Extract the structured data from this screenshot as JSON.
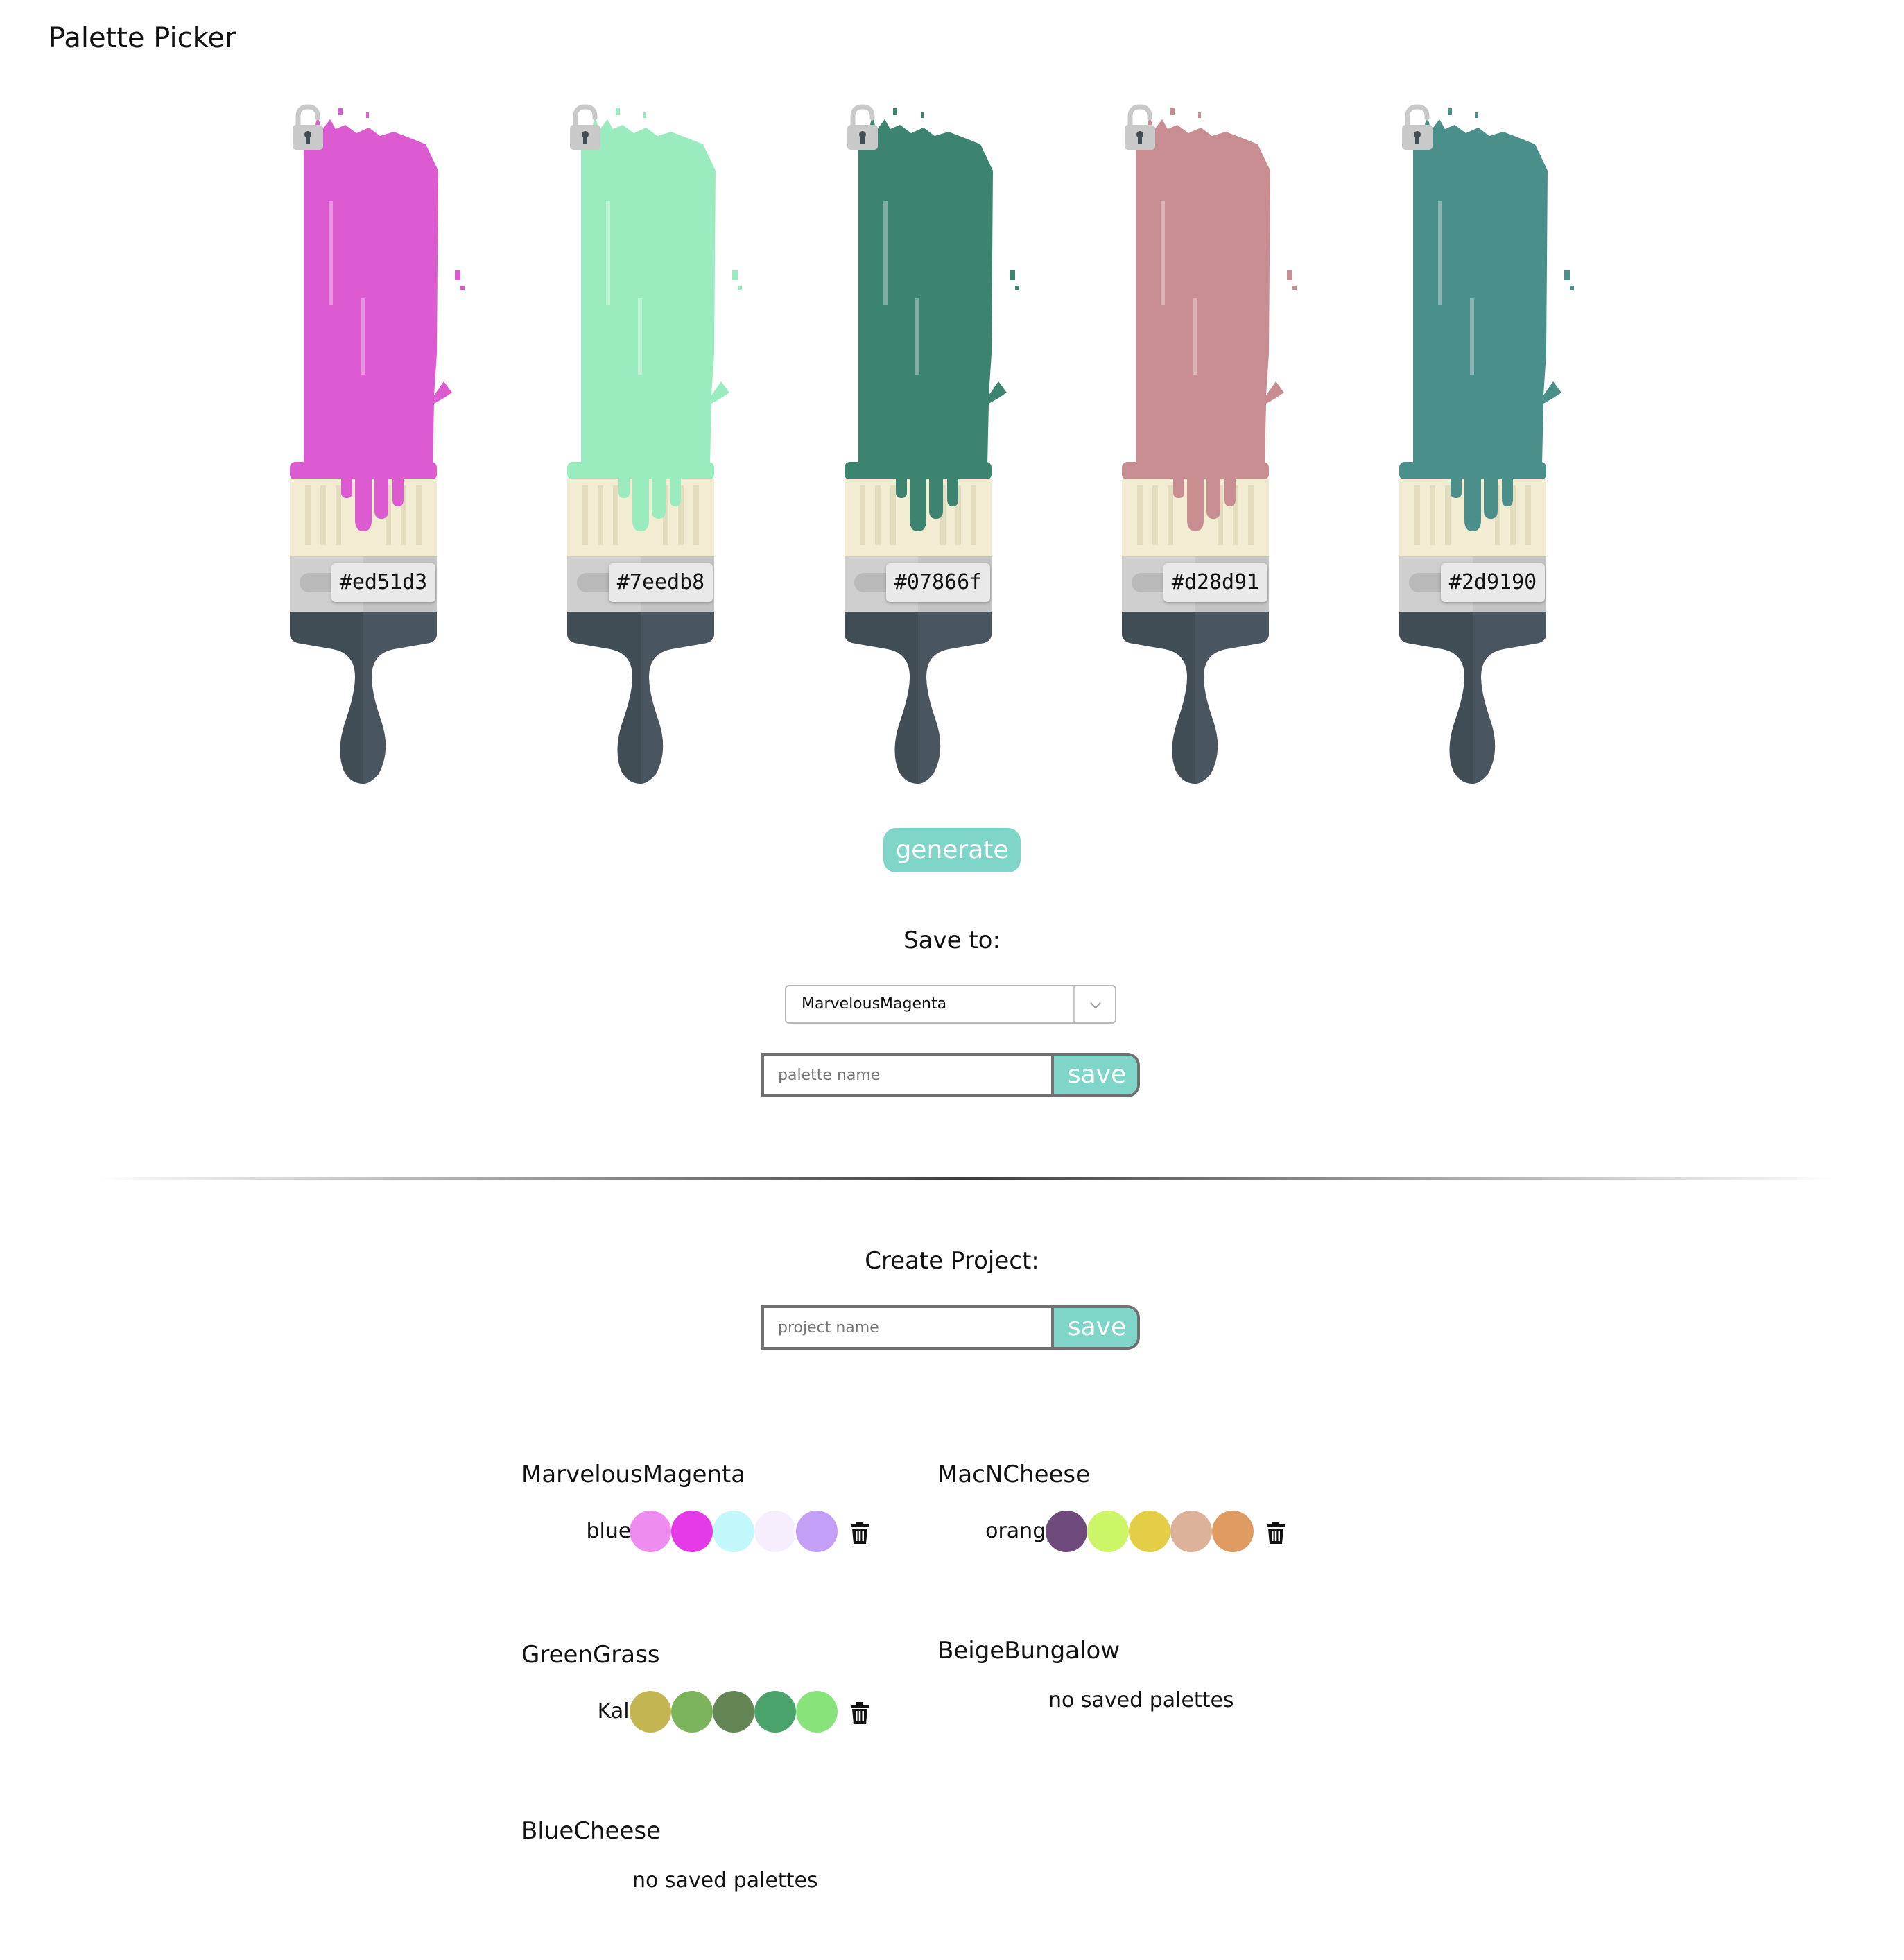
{
  "app": {
    "title": "Palette Picker"
  },
  "brushes": [
    {
      "hex": "#ed51d3",
      "color": "#dc5bd0"
    },
    {
      "hex": "#7eedb8",
      "color": "#9aecbe"
    },
    {
      "hex": "#07866f",
      "color": "#3c8470"
    },
    {
      "hex": "#d28d91",
      "color": "#c88d91"
    },
    {
      "hex": "#2d9190",
      "color": "#4b8f8b"
    }
  ],
  "icons": {
    "lock": "unlocked-lock-icon",
    "trash": "trash-icon",
    "chevron": "chevron-down-icon"
  },
  "generate": {
    "label": "generate"
  },
  "save_to": {
    "label": "Save to:",
    "selected_project": "MarvelousMagenta",
    "palette_placeholder": "palette name",
    "save_label": "save"
  },
  "create_project": {
    "label": "Create Project:",
    "project_placeholder": "project name",
    "save_label": "save"
  },
  "empty_message": "no saved palettes",
  "colors": {
    "accent": "#7fd6c8",
    "handle": "#414d55",
    "ferrule_cream": "#f2ecd2",
    "ferrule_gray": "#cfcfcf"
  },
  "projects": [
    {
      "name": "MarvelousMagenta",
      "palettes": [
        {
          "name": "blues",
          "colors": [
            "#ef8cf0",
            "#e53ae8",
            "#c2f7fb",
            "#f6eefc",
            "#c3a0f5"
          ]
        }
      ]
    },
    {
      "name": "MacNCheese",
      "palettes": [
        {
          "name": "orangy",
          "colors": [
            "#6e4a7c",
            "#ccf567",
            "#e3ce46",
            "#ddb19a",
            "#de9c62"
          ]
        }
      ]
    },
    {
      "name": "GreenGrass",
      "palettes": [
        {
          "name": "Kale",
          "colors": [
            "#c2b552",
            "#7cb45c",
            "#648554",
            "#4aa36b",
            "#88e47a"
          ]
        }
      ]
    },
    {
      "name": "BeigeBungalow",
      "palettes": []
    },
    {
      "name": "BlueCheese",
      "palettes": []
    }
  ]
}
